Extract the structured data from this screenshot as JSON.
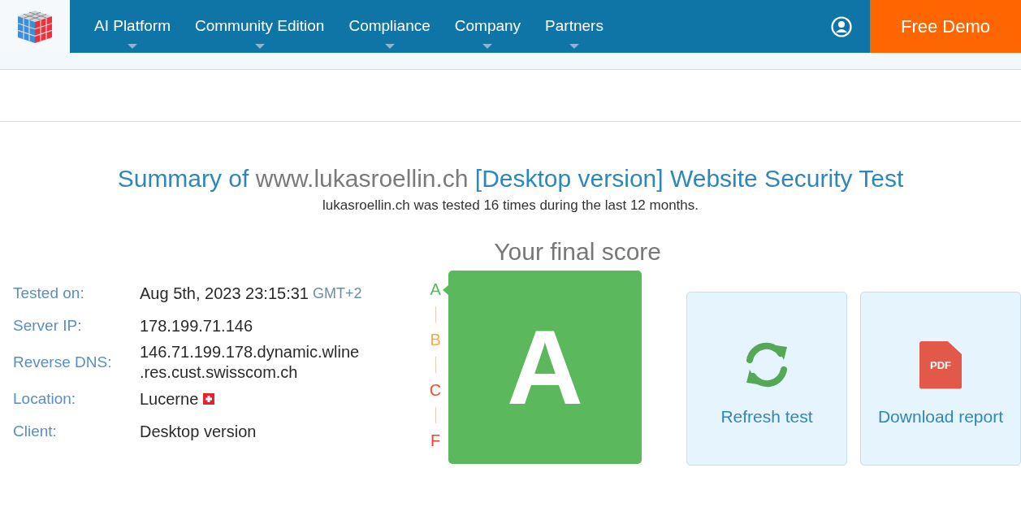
{
  "nav": {
    "items": [
      {
        "label": "AI Platform",
        "has_menu": true
      },
      {
        "label": "Community Edition",
        "has_menu": true
      },
      {
        "label": "Compliance",
        "has_menu": true
      },
      {
        "label": "Company",
        "has_menu": true
      },
      {
        "label": "Partners",
        "has_menu": true
      }
    ],
    "cta": "Free Demo"
  },
  "summary": {
    "title_prefix": "Summary of ",
    "title_domain": "www.lukasroellin.ch",
    "title_suffix": " [Desktop version] Website Security Test",
    "subtitle": "lukasroellin.ch was tested 16 times during the last 12 months."
  },
  "info": [
    {
      "label": "Tested on:",
      "value": "Aug 5th, 2023 23:15:31",
      "suffix": "GMT+2",
      "flag": false
    },
    {
      "label": "Server IP:",
      "value": "178.199.71.146",
      "flag": false
    },
    {
      "label": "Reverse DNS:",
      "value": "146.71.199.178.dynamic.wline .res.cust.swisscom.ch",
      "flag": false
    },
    {
      "label": "Location:",
      "value": "Lucerne",
      "flag": true
    },
    {
      "label": "Client:",
      "value": "Desktop version",
      "flag": false
    }
  ],
  "score": {
    "heading": "Your final score",
    "grade": "A",
    "scale": [
      {
        "letter": "A",
        "color": "#5cb85c",
        "selected": true
      },
      {
        "letter": "B",
        "color": "#f0ad4e",
        "selected": false
      },
      {
        "letter": "C",
        "color": "#f0502e",
        "selected": false
      },
      {
        "letter": "F",
        "color": "#e8412c",
        "selected": false
      }
    ]
  },
  "actions": [
    {
      "kind": "refresh",
      "label": "Refresh test"
    },
    {
      "kind": "pdf",
      "label": "Download report",
      "icon_text": "PDF"
    }
  ]
}
